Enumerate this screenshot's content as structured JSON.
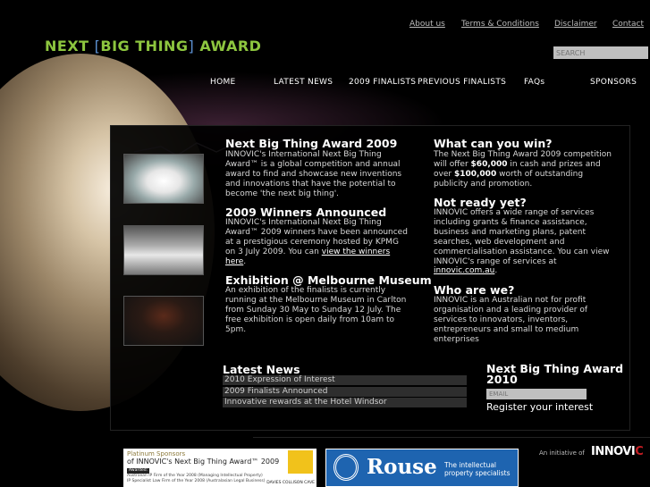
{
  "logo": {
    "part1": "NEXT",
    "part2": "BIG THING",
    "part3": "AWARD"
  },
  "top_links": {
    "about": "About us",
    "terms": "Terms & Conditions",
    "disclaimer": "Disclaimer",
    "contact": "Contact"
  },
  "search": {
    "placeholder": "SEARCH"
  },
  "nav": [
    "HOME",
    "LATEST NEWS",
    "2009 FINALISTS",
    "PREVIOUS FINALISTS",
    "FAQs",
    "SPONSORS"
  ],
  "left_col": {
    "item1": {
      "title": "Next Big Thing Award 2009",
      "text": "INNOVIC's International Next Big Thing Award™ is a global competition and annual award to find and showcase new inventions and innovations that have the potential to become 'the next big thing'."
    },
    "item2": {
      "title": "2009 Winners Announced",
      "text": "INNOVIC's International Next Big Thing Award™ 2009 winners have been announced at a prestigious ceremony hosted by KPMG on 3 July 2009. You can",
      "link": "view the winners here",
      "after": "."
    },
    "item3": {
      "title": "Exhibition @ Melbourne Museum",
      "text": "An exhibition of the finalists is currently running at the Melbourne Museum in Carlton from Sunday 30 May to Sunday 12 July. The free exhibition is open daily from 10am to 5pm."
    }
  },
  "right_col": {
    "win": {
      "title": "What can you win?",
      "text1": "The Next Big Thing Award 2009 competition will offer",
      "cash": "$60,000",
      "text2": "in cash and prizes and over",
      "worth": "$100,000",
      "text3": "worth of outstanding publicity and promotion."
    },
    "ready": {
      "title": "Not ready yet?",
      "text": "INNOVIC offers a wide range of services including grants & finance assistance, business and marketing plans, patent searches, web development and commercialisation assistance. You can view INNOVIC's range of services at",
      "link": "innovic.com.au",
      "after": "."
    },
    "who": {
      "title": "Who are we?",
      "text": "INNOVIC is an Australian not for profit organisation and a leading provider of services to innovators, inventors, entrepreneurs and small to medium enterprises"
    }
  },
  "latest_news": {
    "title": "Latest News",
    "items": [
      "2010 Expression of Interest",
      "2009 Finalists Announced",
      "Innovative rewards at the Hotel Windsor"
    ]
  },
  "register": {
    "title": "Next Big Thing Award 2010",
    "email_placeholder": "EMAIL",
    "button": "Register your interest"
  },
  "footer": {
    "sponsor1": {
      "line1": "Platinum Sponsors",
      "line2": "of INNOVIC's Next Big Thing Award™ 2009",
      "badge": "Awarded:",
      "detail1": "Australian IP Firm of the Year 2008 (Managing Intellectual Property)",
      "detail2": "IP Specialist Law Firm of the Year 2008 (Australasian Legal Business)",
      "firm": "DAVIES COLLISON CAVE"
    },
    "sponsor2": {
      "name": "Rouse",
      "tagline": "The intellectual property specialists"
    },
    "initiative": "An initiative of",
    "brand": {
      "main": "INNOVI",
      "end": "C"
    }
  }
}
